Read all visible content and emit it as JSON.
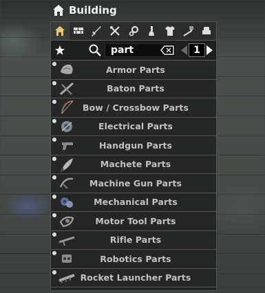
{
  "window": {
    "title": "Building"
  },
  "tabs": [
    {
      "icon": "house-icon",
      "active": true
    },
    {
      "icon": "bricks-icon",
      "active": false
    },
    {
      "icon": "sword-icon",
      "active": false
    },
    {
      "icon": "tools-icon",
      "active": false
    },
    {
      "icon": "gears-icon",
      "active": false
    },
    {
      "icon": "flask-icon",
      "active": false
    },
    {
      "icon": "shirt-icon",
      "active": false
    },
    {
      "icon": "fork-icon",
      "active": false
    },
    {
      "icon": "armchair-icon",
      "active": false
    }
  ],
  "filter": {
    "search_value": "part",
    "page": "1"
  },
  "items": [
    {
      "label": "Armor Parts",
      "icon": "armor-parts-icon"
    },
    {
      "label": "Baton Parts",
      "icon": "baton-parts-icon"
    },
    {
      "label": "Bow / Crossbow Parts",
      "icon": "bow-parts-icon"
    },
    {
      "label": "Electrical Parts",
      "icon": "electrical-parts-icon"
    },
    {
      "label": "Handgun Parts",
      "icon": "handgun-parts-icon"
    },
    {
      "label": "Machete Parts",
      "icon": "machete-parts-icon"
    },
    {
      "label": "Machine Gun Parts",
      "icon": "machine-gun-parts-icon"
    },
    {
      "label": "Mechanical Parts",
      "icon": "mechanical-parts-icon"
    },
    {
      "label": "Motor Tool Parts",
      "icon": "motor-tool-parts-icon"
    },
    {
      "label": "Rifle Parts",
      "icon": "rifle-parts-icon"
    },
    {
      "label": "Robotics Parts",
      "icon": "robotics-parts-icon"
    },
    {
      "label": "Rocket Launcher Parts",
      "icon": "rocket-launcher-parts-icon"
    }
  ],
  "colors": {
    "panel": "#202221",
    "text": "#c2c2c2",
    "title": "#f2f2f2"
  }
}
